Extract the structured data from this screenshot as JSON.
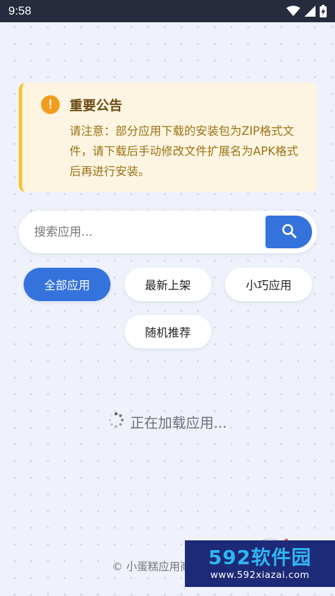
{
  "status_bar": {
    "time": "9:58"
  },
  "notice": {
    "title": "重要公告",
    "icon": "warning-icon",
    "body": "请注意：部分应用下载的安装包为ZIP格式文件，请下载后手动修改文件扩展名为APK格式后再进行安装。"
  },
  "search": {
    "placeholder": "搜索应用...",
    "value": "",
    "icon": "search-icon"
  },
  "filters": [
    {
      "label": "全部应用",
      "active": true
    },
    {
      "label": "最新上架",
      "active": false
    },
    {
      "label": "小巧应用",
      "active": false
    },
    {
      "label": "随机推荐",
      "active": false
    }
  ],
  "loading_text": "正在加载应用...",
  "footer_text": "© 小蛋糕应用商店 - 为",
  "watermark": {
    "logo": "592软件园",
    "url": "www.592xiazai.com"
  },
  "colors": {
    "accent": "#3573dc",
    "notice_bg": "#fdf5e1",
    "notice_border": "#f5c431",
    "warning": "#f29c1d",
    "status_bar": "#262b3d"
  }
}
